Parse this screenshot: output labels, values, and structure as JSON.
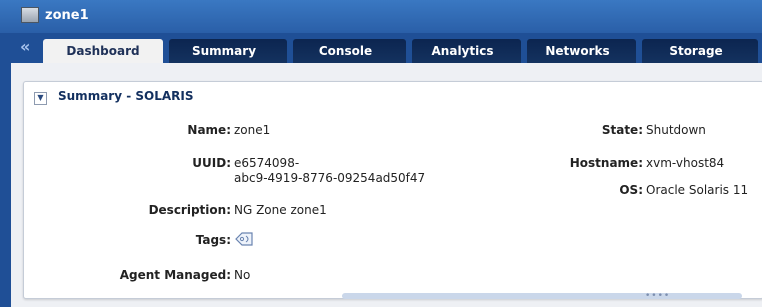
{
  "window": {
    "title": "zone1"
  },
  "nav": {
    "collapse_glyph": "«",
    "tabs": [
      {
        "label": "Dashboard",
        "active": true
      },
      {
        "label": "Summary",
        "active": false
      },
      {
        "label": "Console",
        "active": false
      },
      {
        "label": "Analytics",
        "active": false
      },
      {
        "label": "Networks",
        "active": false
      },
      {
        "label": "Storage",
        "active": false
      }
    ]
  },
  "panel": {
    "title": "Summary - SOLARIS",
    "fields": {
      "name": {
        "label": "Name:",
        "value": "zone1"
      },
      "uuid": {
        "label": "UUID:",
        "value_line1": "e6574098-",
        "value_line2": "abc9-4919-8776-09254ad50f47"
      },
      "description": {
        "label": "Description:",
        "value": "NG Zone zone1"
      },
      "tags": {
        "label": "Tags:",
        "icon": "tag-icon"
      },
      "agent_managed": {
        "label": "Agent Managed:",
        "value": "No"
      },
      "state": {
        "label": "State:",
        "value": "Shutdown"
      },
      "hostname": {
        "label": "Hostname:",
        "value": "xvm-vhost84"
      },
      "os": {
        "label": "OS:",
        "value": "Oracle Solaris 11"
      }
    }
  },
  "colors": {
    "header_blue": "#2a5fa8",
    "tab_dark": "#0c2550",
    "accent": "#1f4f96"
  }
}
